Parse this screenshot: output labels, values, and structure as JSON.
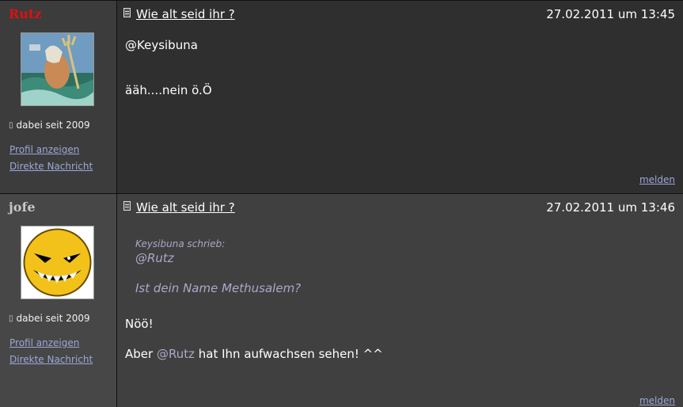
{
  "posts": [
    {
      "username": "Rutz",
      "member_since": "dabei seit 2009",
      "profile_link": "Profil anzeigen",
      "dm_link": "Direkte Nachricht",
      "topic_title": "Wie alt seid ihr ?",
      "timestamp": "27.02.2011 um 13:45",
      "mention": "@Keysibuna",
      "body": "ääh....nein ö.Ö",
      "report": "melden",
      "avatar_icon": "poseidon-avatar-icon"
    },
    {
      "username": "jofe",
      "member_since": "dabei seit 2009",
      "profile_link": "Profil anzeigen",
      "dm_link": "Direkte Nachricht",
      "topic_title": "Wie alt seid ihr ?",
      "timestamp": "27.02.2011 um 13:46",
      "quote": {
        "author": "Keysibuna schrieb:",
        "line1": "@Rutz",
        "line2": "Ist dein Name Methusalem?"
      },
      "body_line1": "Nöö!",
      "body_line2_prefix": "Aber",
      "body_line2_mention": "@Rutz",
      "body_line2_suffix": "hat Ihn aufwachsen sehen! ^^",
      "report": "melden",
      "avatar_icon": "grinning-smiley-avatar-icon"
    }
  ],
  "colors": {
    "username_highlight": "#e01010",
    "link": "#9aa8d8",
    "mention": "#a9a9c8"
  }
}
